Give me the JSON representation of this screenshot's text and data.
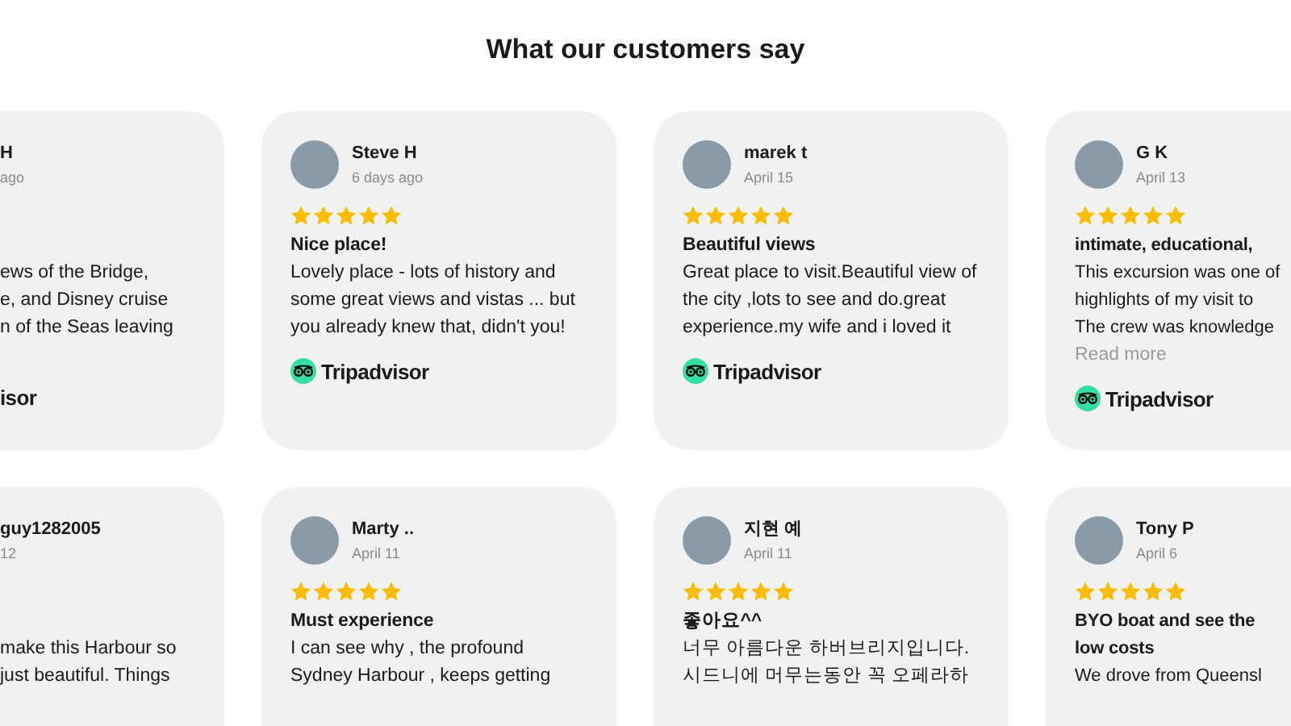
{
  "heading": "What our customers say",
  "rows": [
    [
      {
        "kind": "clipped-left",
        "name": "H",
        "date": "ago",
        "body": "ews of the Bridge,\ne, and Disney cruise\nn of the Seas leaving",
        "source": "isor"
      },
      {
        "kind": "full",
        "name": "Steve H",
        "date": "6 days ago",
        "stars": 5,
        "title": "Nice place!",
        "body": "Lovely place - lots of history and some great views and vistas ... but you already knew that, didn't you!",
        "source": "Tripadvisor"
      },
      {
        "kind": "full",
        "name": "marek t",
        "date": "April 15",
        "stars": 5,
        "title": "Beautiful views",
        "body": "Great place to visit.Beautiful view of the city ,lots to see and do.great experience.my wife and i loved it",
        "source": "Tripadvisor"
      },
      {
        "kind": "clipped-right",
        "name": "G K",
        "date": "April 13",
        "stars": 5,
        "title": "intimate, educational,",
        "body": "This excursion was one of\nhighlights of my visit to\nThe crew was knowledge",
        "read_more": "Read more",
        "source": "Tripadvisor"
      }
    ],
    [
      {
        "kind": "clipped-left",
        "name": "guy1282005",
        "date": "12",
        "body": "make this Harbour so\njust beautiful. Things"
      },
      {
        "kind": "full",
        "name": "Marty ..",
        "date": "April 11",
        "stars": 5,
        "title": "Must experience",
        "body": "I can see why , the profound\nSydney Harbour , keeps getting"
      },
      {
        "kind": "full",
        "name": "지현 예",
        "date": "April 11",
        "stars": 5,
        "title": "좋아요^^",
        "body": "너무 아름다운 하버브리지입니다.\n시드니에 머무는동안 꼭 오페라하"
      },
      {
        "kind": "clipped-right",
        "name": "Tony P",
        "date": "April 6",
        "stars": 5,
        "title": "BYO boat and see the\nlow costs",
        "body": "We drove from Queensl"
      }
    ]
  ]
}
